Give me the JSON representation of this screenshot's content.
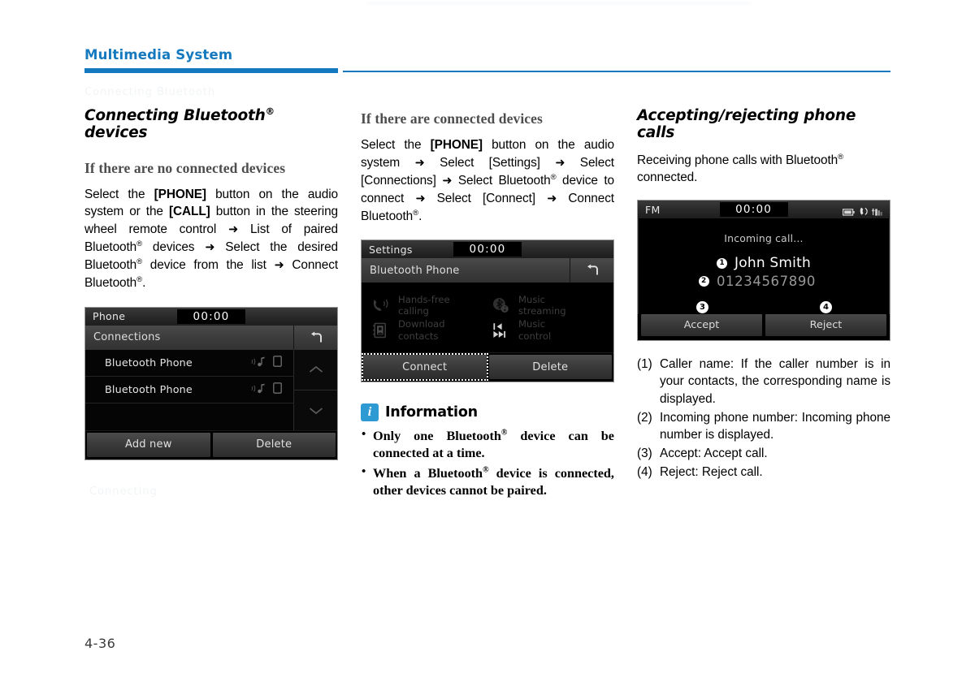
{
  "header": {
    "running_title": "Multimedia System",
    "accent_color": "#1479be"
  },
  "folio": "4-36",
  "ghost_text": {
    "g1": "Connecting Bluetooth",
    "g2": "Connecting Bluetooth",
    "g3": "Connecting"
  },
  "columns": {
    "left": {
      "section_title_pre": "Connecting Bluetooth",
      "section_title_post": " devices",
      "sub_title": "If there are no connected devices",
      "body": {
        "t1": "Select the ",
        "b1": "[PHONE]",
        "t2": " button on the audio system or the ",
        "b2": "[CALL]",
        "t3": " button in the steering wheel remote control ",
        "a1": "➜",
        "t4": " List of paired Bluetooth",
        "r1": "®",
        "t5": " devices ",
        "a2": "➜",
        "t6": " Select the desired Bluetooth",
        "r2": "®",
        "t7": " device from the list ",
        "a3": "➜",
        "t8": " Connect Bluetooth",
        "r3": "®",
        "t9": "."
      },
      "device": {
        "mode": "Phone",
        "clock": "00:00",
        "title": "Connections",
        "back_icon": "back-arrow-icon",
        "rows": [
          {
            "label": "Bluetooth Phone",
            "icons": [
              "bluetooth-audio-icon",
              "device-icon"
            ]
          },
          {
            "label": "Bluetooth Phone",
            "icons": [
              "bluetooth-audio-icon",
              "device-icon"
            ]
          },
          {
            "label": "",
            "icons": []
          }
        ],
        "scroll_up": "chevron-up-icon",
        "scroll_down": "chevron-down-icon",
        "buttons": [
          {
            "label": "Add new",
            "selected": false
          },
          {
            "label": "Delete",
            "selected": false
          }
        ]
      }
    },
    "middle": {
      "sub_title": "If there are connected devices",
      "body": {
        "t1": "Select the ",
        "b1": "[PHONE]",
        "t2": " button on the audio system ",
        "a1": "➜",
        "t3": " Select [Settings] ",
        "a2": "➜",
        "t4": " Select [Connections] ",
        "a3": "➜",
        "t5": " Select Bluetooth",
        "r1": "®",
        "t6": " device to connect ",
        "a4": "➜",
        "t7": " Select [Connect] ",
        "a5": "➜",
        "t8": " Connect Bluetooth",
        "r2": "®",
        "t9": "."
      },
      "device": {
        "mode": "Settings",
        "clock": "00:00",
        "title": "Bluetooth Phone",
        "back_icon": "back-arrow-icon",
        "features": [
          {
            "label_1": "Hands-free",
            "label_2": "calling",
            "icon": "handsfree-calling-icon"
          },
          {
            "label_1": "Music",
            "label_2": "streaming",
            "icon": "bluetooth-music-icon"
          },
          {
            "label_1": "Download",
            "label_2": "contacts",
            "icon": "contacts-download-icon"
          },
          {
            "label_1": "Music",
            "label_2": "control",
            "icon": "track-skip-icon"
          }
        ],
        "buttons": [
          {
            "label": "Connect",
            "selected": true
          },
          {
            "label": "Delete",
            "selected": false
          }
        ]
      },
      "information": {
        "icon": "info-icon",
        "icon_glyph": "i",
        "title": "Information",
        "items": [
          {
            "t1": "Only one Bluetooth",
            "r1": "®",
            "t2": " device can be connected at a time."
          },
          {
            "t1": "When a Bluetooth",
            "r1": "®",
            "t2": " device is connected, other devices cannot be paired."
          }
        ]
      }
    },
    "right": {
      "section_title": "Accepting/rejecting phone calls",
      "body": {
        "t1": "Receiving phone calls with Bluetooth",
        "r1": "®",
        "t2": " connected."
      },
      "device": {
        "mode": "FM",
        "clock": "00:00",
        "status_icons": [
          "battery-icon",
          "phone-handset-icon",
          "signal-bars-icon"
        ],
        "call_status": "Incoming call...",
        "caller_name": "John Smith",
        "caller_name_marker": "1",
        "caller_number": "01234567890",
        "caller_number_marker": "2",
        "buttons": [
          {
            "label": "Accept",
            "marker": "3"
          },
          {
            "label": "Reject",
            "marker": "4"
          }
        ]
      },
      "legend": [
        {
          "marker": "(1)",
          "text": "Caller name: If the caller number is in your contacts, the corresponding name is displayed."
        },
        {
          "marker": "(2)",
          "text": "Incoming phone number: Incoming phone number is displayed."
        },
        {
          "marker": "(3)",
          "text": "Accept: Accept call."
        },
        {
          "marker": "(4)",
          "text": "Reject: Reject call."
        }
      ]
    }
  }
}
